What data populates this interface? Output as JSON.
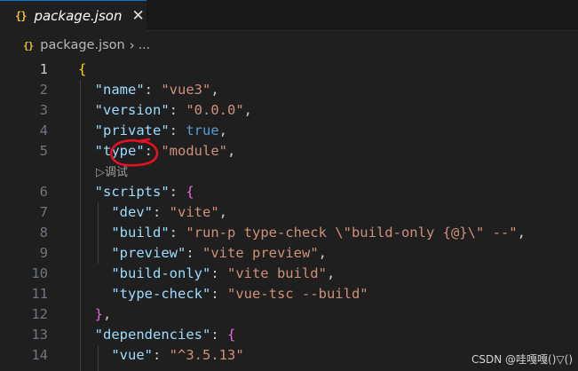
{
  "tab": {
    "icon": "{}",
    "title": "package.json",
    "close": "✕"
  },
  "breadcrumb": {
    "icon": "{}",
    "file": "package.json",
    "separator": "›",
    "more": "..."
  },
  "codelens": "▷调试",
  "lines": [
    {
      "num": "1",
      "tokens": [
        {
          "t": "{",
          "c": "brace"
        }
      ]
    },
    {
      "num": "2",
      "tokens": [
        {
          "t": "  "
        },
        {
          "t": "\"name\"",
          "c": "key"
        },
        {
          "t": ": "
        },
        {
          "t": "\"vue3\"",
          "c": "str"
        },
        {
          "t": ","
        }
      ]
    },
    {
      "num": "3",
      "tokens": [
        {
          "t": "  "
        },
        {
          "t": "\"version\"",
          "c": "key"
        },
        {
          "t": ": "
        },
        {
          "t": "\"0.0.0\"",
          "c": "str"
        },
        {
          "t": ","
        }
      ]
    },
    {
      "num": "4",
      "tokens": [
        {
          "t": "  "
        },
        {
          "t": "\"private\"",
          "c": "key"
        },
        {
          "t": ": "
        },
        {
          "t": "true",
          "c": "bool"
        },
        {
          "t": ","
        }
      ]
    },
    {
      "num": "5",
      "tokens": [
        {
          "t": "  "
        },
        {
          "t": "\"type\"",
          "c": "key"
        },
        {
          "t": ": "
        },
        {
          "t": "\"module\"",
          "c": "str"
        },
        {
          "t": ","
        }
      ]
    },
    {
      "num": "6",
      "tokens": [
        {
          "t": "  "
        },
        {
          "t": "\"scripts\"",
          "c": "key"
        },
        {
          "t": ": "
        },
        {
          "t": "{",
          "c": "brace2"
        }
      ]
    },
    {
      "num": "7",
      "tokens": [
        {
          "t": "    "
        },
        {
          "t": "\"dev\"",
          "c": "key"
        },
        {
          "t": ": "
        },
        {
          "t": "\"vite\"",
          "c": "str"
        },
        {
          "t": ","
        }
      ]
    },
    {
      "num": "8",
      "tokens": [
        {
          "t": "    "
        },
        {
          "t": "\"build\"",
          "c": "key"
        },
        {
          "t": ": "
        },
        {
          "t": "\"run-p type-check \\\"build-only {@}\\\" --\"",
          "c": "str"
        },
        {
          "t": ","
        }
      ]
    },
    {
      "num": "9",
      "tokens": [
        {
          "t": "    "
        },
        {
          "t": "\"preview\"",
          "c": "key"
        },
        {
          "t": ": "
        },
        {
          "t": "\"vite preview\"",
          "c": "str"
        },
        {
          "t": ","
        }
      ]
    },
    {
      "num": "10",
      "tokens": [
        {
          "t": "    "
        },
        {
          "t": "\"build-only\"",
          "c": "key"
        },
        {
          "t": ": "
        },
        {
          "t": "\"vite build\"",
          "c": "str"
        },
        {
          "t": ","
        }
      ]
    },
    {
      "num": "11",
      "tokens": [
        {
          "t": "    "
        },
        {
          "t": "\"type-check\"",
          "c": "key"
        },
        {
          "t": ": "
        },
        {
          "t": "\"vue-tsc --build\"",
          "c": "str"
        }
      ]
    },
    {
      "num": "12",
      "tokens": [
        {
          "t": "  "
        },
        {
          "t": "}",
          "c": "brace2"
        },
        {
          "t": ","
        }
      ]
    },
    {
      "num": "13",
      "tokens": [
        {
          "t": "  "
        },
        {
          "t": "\"dependencies\"",
          "c": "key"
        },
        {
          "t": ": "
        },
        {
          "t": "{",
          "c": "brace2"
        }
      ]
    },
    {
      "num": "14",
      "tokens": [
        {
          "t": "    "
        },
        {
          "t": "\"vue\"",
          "c": "key"
        },
        {
          "t": ": "
        },
        {
          "t": "\"^3.5.13\"",
          "c": "str"
        }
      ]
    }
  ],
  "watermark": "CSDN @哇嘎嘎()▽()",
  "colors": {
    "key": "#9cdcfe",
    "string": "#ce9178",
    "boolean": "#569cd6",
    "bracket_level1": "#ffd700",
    "bracket_level2": "#da70d6",
    "annotation": "#e81123",
    "accent": "#0078d4"
  }
}
